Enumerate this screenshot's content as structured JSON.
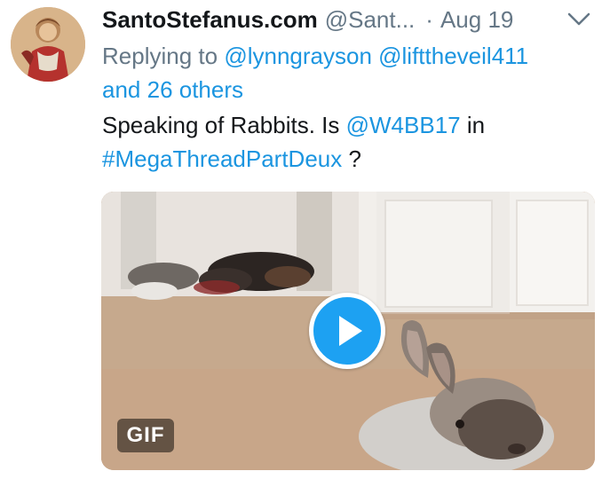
{
  "tweet": {
    "display_name": "SantoStefanus.com",
    "handle": "@Sant...",
    "separator": "·",
    "timestamp": "Aug 19",
    "menu_icon": "chevron-down-icon",
    "avatar_icon": "avatar-painting"
  },
  "reply_context": {
    "prefix": "Replying to",
    "mention_1": "@lynngrayson",
    "mention_2": "@lifttheveil411",
    "others": "and 26 others"
  },
  "body": {
    "text_1": "Speaking of Rabbits. Is",
    "mention": "@W4BB17",
    "text_2": "in",
    "hashtag": "#MegaThreadPartDeux",
    "text_3": "?"
  },
  "media": {
    "badge": "GIF",
    "play_icon": "play-icon"
  },
  "colors": {
    "link": "#1b95e0",
    "secondary": "#657786",
    "play_button": "#1da1f2"
  }
}
